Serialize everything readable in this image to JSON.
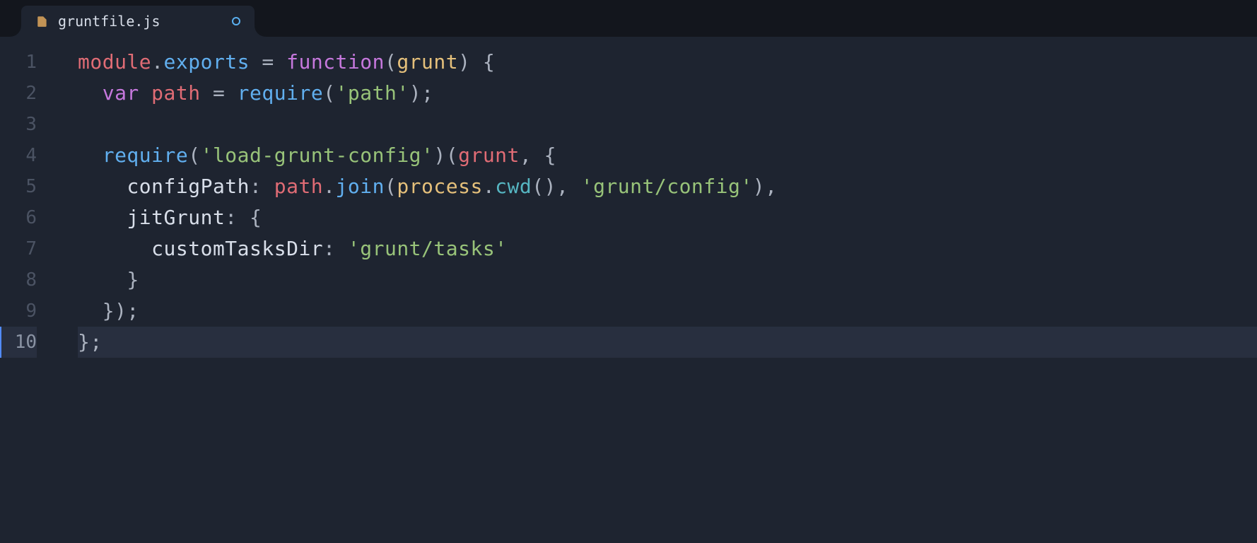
{
  "tab": {
    "title": "gruntfile.js",
    "modified": true
  },
  "cursorLine": 10,
  "lineNumbers": [
    "1",
    "2",
    "3",
    "4",
    "5",
    "6",
    "7",
    "8",
    "9",
    "10"
  ],
  "code": {
    "module": "module",
    "dot": ".",
    "exports": "exports",
    "eq": " = ",
    "function": "function",
    "lparen": "(",
    "rparen": ")",
    "grunt": "grunt",
    "lbrace": " {",
    "lbrace_only": "{",
    "rbrace": "}",
    "var": "var",
    "sp": " ",
    "path": "path",
    "require": "require",
    "str_path": "'path'",
    "semi": ";",
    "str_loadgruntconfig": "'load-grunt-config'",
    "comma": ", ",
    "configPath": "configPath",
    "colon": ": ",
    "join": "join",
    "process": "process",
    "cwd": "cwd",
    "str_gruntconfig": "'grunt/config'",
    "jitGrunt": "jitGrunt",
    "customTasksDir": "customTasksDir",
    "str_grunttasks": "'grunt/tasks'",
    "rparen_semi": ");",
    "indent1": "  ",
    "indent2": "    ",
    "indent3": "      ",
    "indent4": "        "
  }
}
